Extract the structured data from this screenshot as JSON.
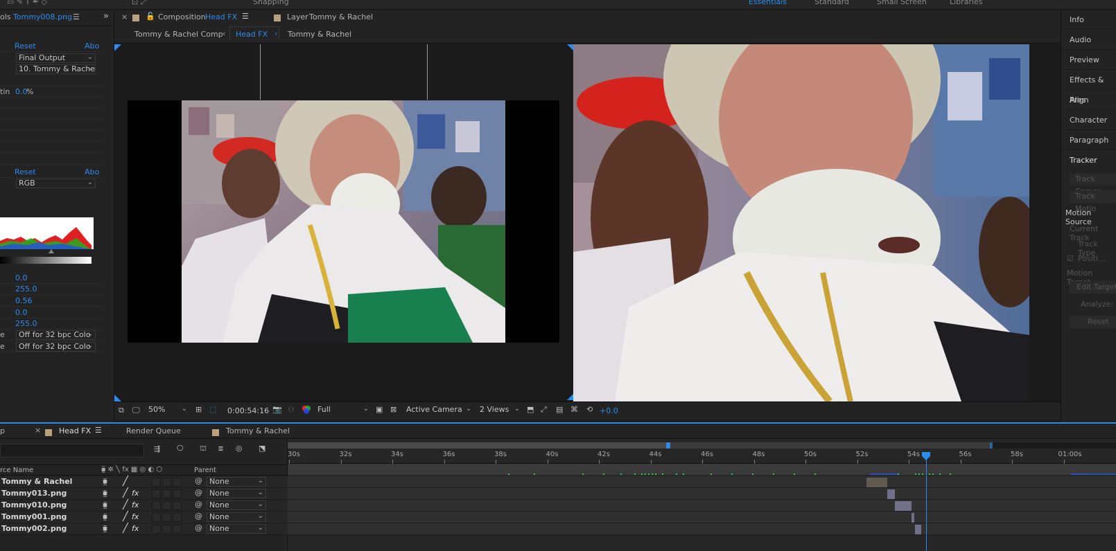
{
  "topbar": {
    "workspaces": [
      "Essentials",
      "Standard",
      "Small Screen",
      "Libraries"
    ],
    "snapping": "Snapping"
  },
  "effect_controls": {
    "tab_prefix": "ols",
    "tab_file": "Tommy008.png",
    "reset": "Reset",
    "about": "Abo",
    "render_dropdown": "Final Output",
    "layer_dropdown": "10. Tommy & Rache",
    "blend_label": "tin",
    "blend_value": "0.0",
    "blend_unit": "%",
    "reset2": "Reset",
    "about2": "Abo",
    "channel_dropdown": "RGB",
    "levels": [
      "0.0",
      "255.0",
      "0.56",
      "0.0",
      "255.0"
    ],
    "clip_dropdown_1": "Off for 32 bpc Colo",
    "clip_dropdown_2": "Off for 32 bpc Colo",
    "clip_label_1": "e",
    "clip_label_2": "e"
  },
  "comp_panel": {
    "comp_tab_prefix": "Composition",
    "comp_tab_name": "Head FX",
    "layer_tab_prefix": "Layer",
    "layer_tab_name": "Tommy & Rachel",
    "breadcrumbs": [
      "Tommy & Rachel Comp",
      "Head FX",
      "Tommy & Rachel"
    ]
  },
  "viewer_toolbar": {
    "zoom": "50%",
    "timecode": "0:00:54:16",
    "resolution": "Full",
    "camera": "Active Camera",
    "views": "2 Views",
    "exposure": "+0.0"
  },
  "right_panel": {
    "items": [
      "Info",
      "Audio",
      "Preview",
      "Effects & Pres",
      "Align",
      "Character",
      "Paragraph",
      "Tracker"
    ],
    "tracker": {
      "track_camera": "Track Camer",
      "track_motion": "Track Motio",
      "motion_source": "Motion Source",
      "current_track": "Current Track",
      "track_type": "Track Type",
      "position": "Positi...",
      "motion_target": "Motion Target",
      "edit_target": "Edit Target",
      "analyze": "Analyze:",
      "reset": "Reset"
    }
  },
  "timeline": {
    "tab_prefix": "p",
    "tabs": [
      "Head FX",
      "Render Queue",
      "Tommy & Rachel"
    ],
    "col_source": "rce Name",
    "col_parent": "Parent",
    "ruler": [
      "30s",
      "32s",
      "34s",
      "36s",
      "38s",
      "40s",
      "42s",
      "44s",
      "46s",
      "48s",
      "50s",
      "52s",
      "54s",
      "56s",
      "58s",
      "01:00s"
    ],
    "layers": [
      {
        "name": "Tommy & Rachel",
        "fx": "",
        "parent": "None"
      },
      {
        "name": "Tommy013.png",
        "fx": "fx",
        "parent": "None"
      },
      {
        "name": "Tommy010.png",
        "fx": "fx",
        "parent": "None"
      },
      {
        "name": "Tommy001.png",
        "fx": "fx",
        "parent": "None"
      },
      {
        "name": "Tommy002.png",
        "fx": "fx",
        "parent": "None"
      }
    ]
  },
  "colors": {
    "accent": "#2d8ceb",
    "panel": "#232323",
    "swatch": "#b7a17f",
    "layer_bar": "#6f6f86"
  }
}
